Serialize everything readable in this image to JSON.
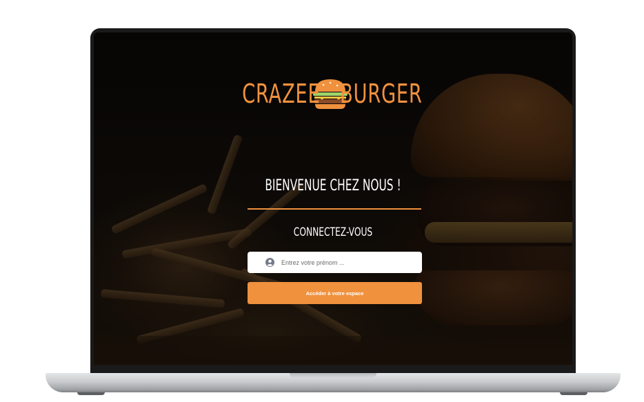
{
  "brand": {
    "name_left": "CRAZEE",
    "name_right": "BURGER",
    "icon": "burger-icon",
    "accent_color": "#f0913e"
  },
  "login": {
    "welcome_title": "BIENVENUE CHEZ NOUS !",
    "subtitle": "CONNECTEZ-VOUS",
    "input_icon": "user-circle-icon",
    "input_placeholder": "Entrez votre prénom ...",
    "submit_label": "Accéder à votre espace"
  }
}
